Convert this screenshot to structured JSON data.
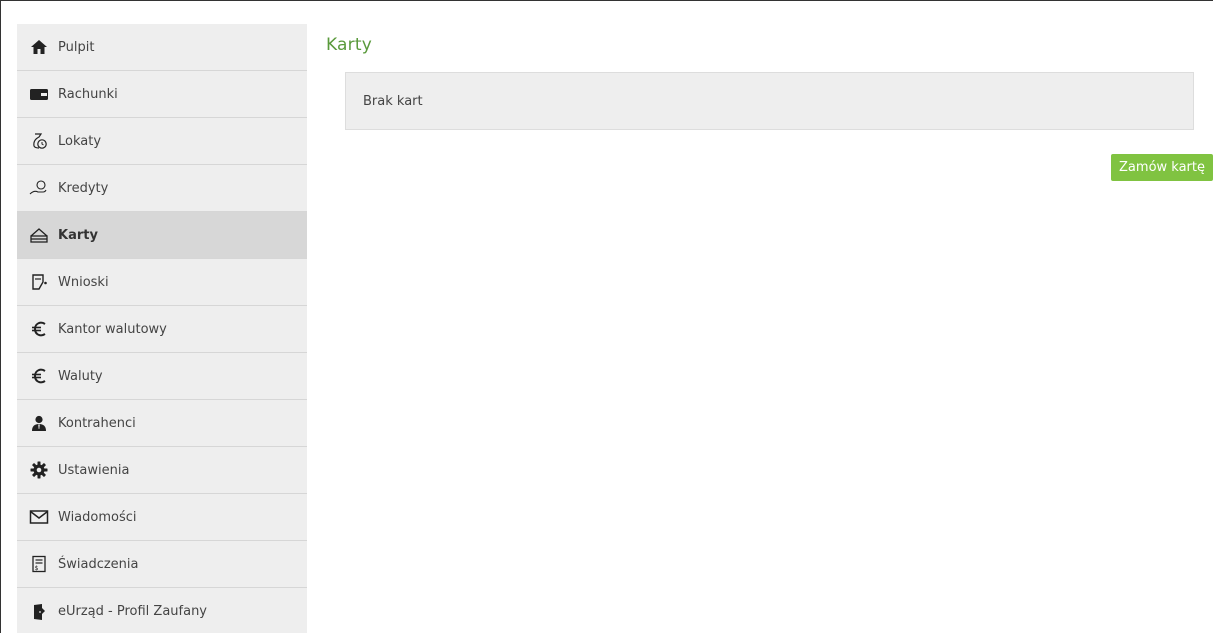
{
  "sidebar": {
    "items": [
      {
        "label": "Pulpit",
        "icon": "home-icon"
      },
      {
        "label": "Rachunki",
        "icon": "wallet-icon"
      },
      {
        "label": "Lokaty",
        "icon": "money-bag-icon"
      },
      {
        "label": "Kredyty",
        "icon": "hand-coin-icon"
      },
      {
        "label": "Karty",
        "icon": "card-icon",
        "active": true
      },
      {
        "label": "Wnioski",
        "icon": "form-icon"
      },
      {
        "label": "Kantor walutowy",
        "icon": "euro-icon"
      },
      {
        "label": "Waluty",
        "icon": "euro-icon"
      },
      {
        "label": "Kontrahenci",
        "icon": "person-icon"
      },
      {
        "label": "Ustawienia",
        "icon": "gear-icon"
      },
      {
        "label": "Wiadomości",
        "icon": "envelope-icon"
      },
      {
        "label": "Świadczenia",
        "icon": "benefit-icon"
      },
      {
        "label": "eUrząd - Profil Zaufany",
        "icon": "door-icon"
      }
    ]
  },
  "main": {
    "title": "Karty",
    "empty_message": "Brak kart",
    "order_button_label": "Zamów kartę"
  },
  "colors": {
    "accent_green": "#80c341",
    "title_green": "#5a9a3c",
    "sidebar_bg": "#eeeeee",
    "active_bg": "#d7d7d7"
  }
}
